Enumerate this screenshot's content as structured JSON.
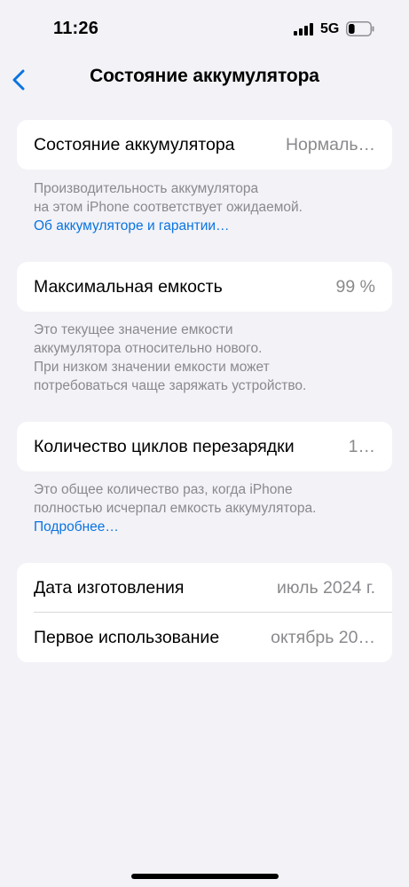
{
  "status_bar": {
    "time": "11:26",
    "network": "5G",
    "battery_level": 0.3
  },
  "nav": {
    "back_icon": "chevron-left-icon",
    "title": "Состояние аккумулятора"
  },
  "sections": {
    "health": {
      "label": "Состояние аккумулятора",
      "value": "Нормаль…",
      "footer_line1": "Производительность аккумулятора",
      "footer_line2": "на этом iPhone соответствует ожидаемой.",
      "footer_link": "Об аккумуляторе и гарантии…"
    },
    "capacity": {
      "label": "Максимальная емкость",
      "value": "99 %",
      "footer_line1": "Это текущее значение емкости",
      "footer_line2": "аккумулятора относительно нового.",
      "footer_line3": "При низком значении емкости может",
      "footer_line4": "потребоваться чаще заряжать устройство."
    },
    "cycles": {
      "label": "Количество циклов перезарядки",
      "value": "1…",
      "footer_line1": "Это общее количество раз, когда iPhone",
      "footer_line2": "полностью исчерпал емкость аккумулятора.",
      "footer_link": "Подробнее…"
    },
    "dates": {
      "manufacture_label": "Дата изготовления",
      "manufacture_value": "июль 2024 г.",
      "first_use_label": "Первое использование",
      "first_use_value": "октябрь 20…"
    }
  },
  "colors": {
    "accent": "#0a74e0",
    "background": "#f2f2f7",
    "secondary_text": "#8a8a8e"
  }
}
